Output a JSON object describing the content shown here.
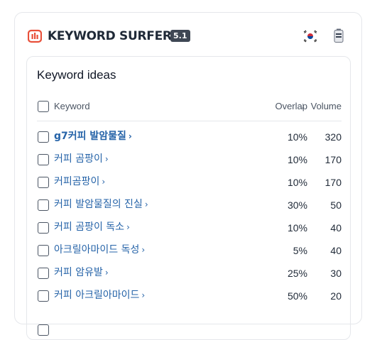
{
  "app": {
    "brand": "KEYWORD SURFER",
    "version": "5.1",
    "icons": {
      "logo": "surfer-logo-icon",
      "flag": "korea-flag-icon",
      "extension": "battery-icon"
    },
    "colors": {
      "accent": "#e8503a",
      "link": "#2563a8",
      "badge": "#3f4754"
    }
  },
  "panel": {
    "title": "Keyword ideas",
    "columns": {
      "keyword": "Keyword",
      "overlap": "Overlap",
      "volume_arrow": "↓",
      "volume": "Volume"
    },
    "rows": [
      {
        "keyword": "g7커피 발암물질",
        "overlap": "10%",
        "volume": "320",
        "chevron": "›"
      },
      {
        "keyword": "커피 곰팡이",
        "overlap": "10%",
        "volume": "170",
        "chevron": "›"
      },
      {
        "keyword": "커피곰팡이",
        "overlap": "10%",
        "volume": "170",
        "chevron": "›"
      },
      {
        "keyword": "커피 발암물질의 진실",
        "overlap": "30%",
        "volume": "50",
        "chevron": "›"
      },
      {
        "keyword": "커피 곰팡이 독소",
        "overlap": "10%",
        "volume": "40",
        "chevron": "›"
      },
      {
        "keyword": "아크릴아마이드 독성",
        "overlap": "5%",
        "volume": "40",
        "chevron": "›"
      },
      {
        "keyword": "커피 암유발",
        "overlap": "25%",
        "volume": "30",
        "chevron": "›"
      },
      {
        "keyword": "커피 아크릴아마이드",
        "overlap": "50%",
        "volume": "20",
        "chevron": "›"
      }
    ]
  }
}
